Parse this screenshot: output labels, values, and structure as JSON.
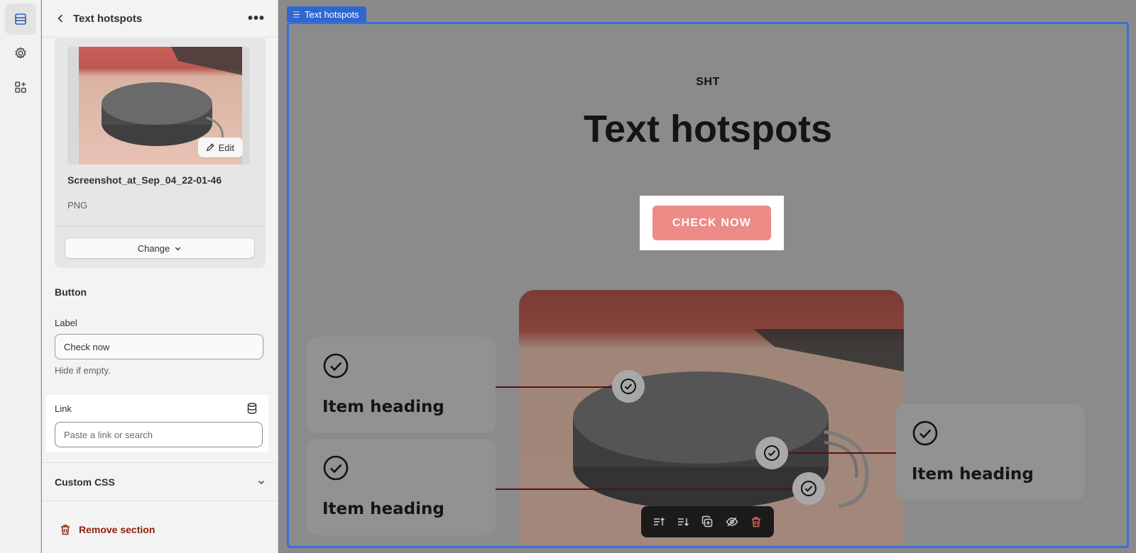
{
  "panel": {
    "title": "Text hotspots",
    "more": "•••"
  },
  "media": {
    "edit_label": "Edit",
    "file_name": "Screenshot_at_Sep_04_22-01-46",
    "file_type": "PNG",
    "change_label": "Change"
  },
  "button_section": {
    "heading": "Button",
    "label_field_label": "Label",
    "label_value": "Check now",
    "label_hint": "Hide if empty.",
    "link_field_label": "Link",
    "link_placeholder": "Paste a link or search"
  },
  "custom_css": {
    "label": "Custom CSS"
  },
  "remove": {
    "label": "Remove section"
  },
  "preview": {
    "tag": "Text hotspots",
    "eyebrow": "SHT",
    "title": "Text hotspots",
    "cta": "CHECK NOW",
    "cards": [
      {
        "heading": "Item heading"
      },
      {
        "heading": "Item heading"
      },
      {
        "heading": "Item heading"
      }
    ]
  },
  "colors": {
    "accent": "#2f66d0",
    "cta": "#ed8b86",
    "danger": "#8e1f0b"
  },
  "icons": {
    "rail": [
      "sections-icon",
      "gear-icon",
      "apps-icon"
    ],
    "toolbar": [
      "move-up-icon",
      "move-down-icon",
      "duplicate-icon",
      "hide-icon",
      "delete-icon"
    ]
  }
}
